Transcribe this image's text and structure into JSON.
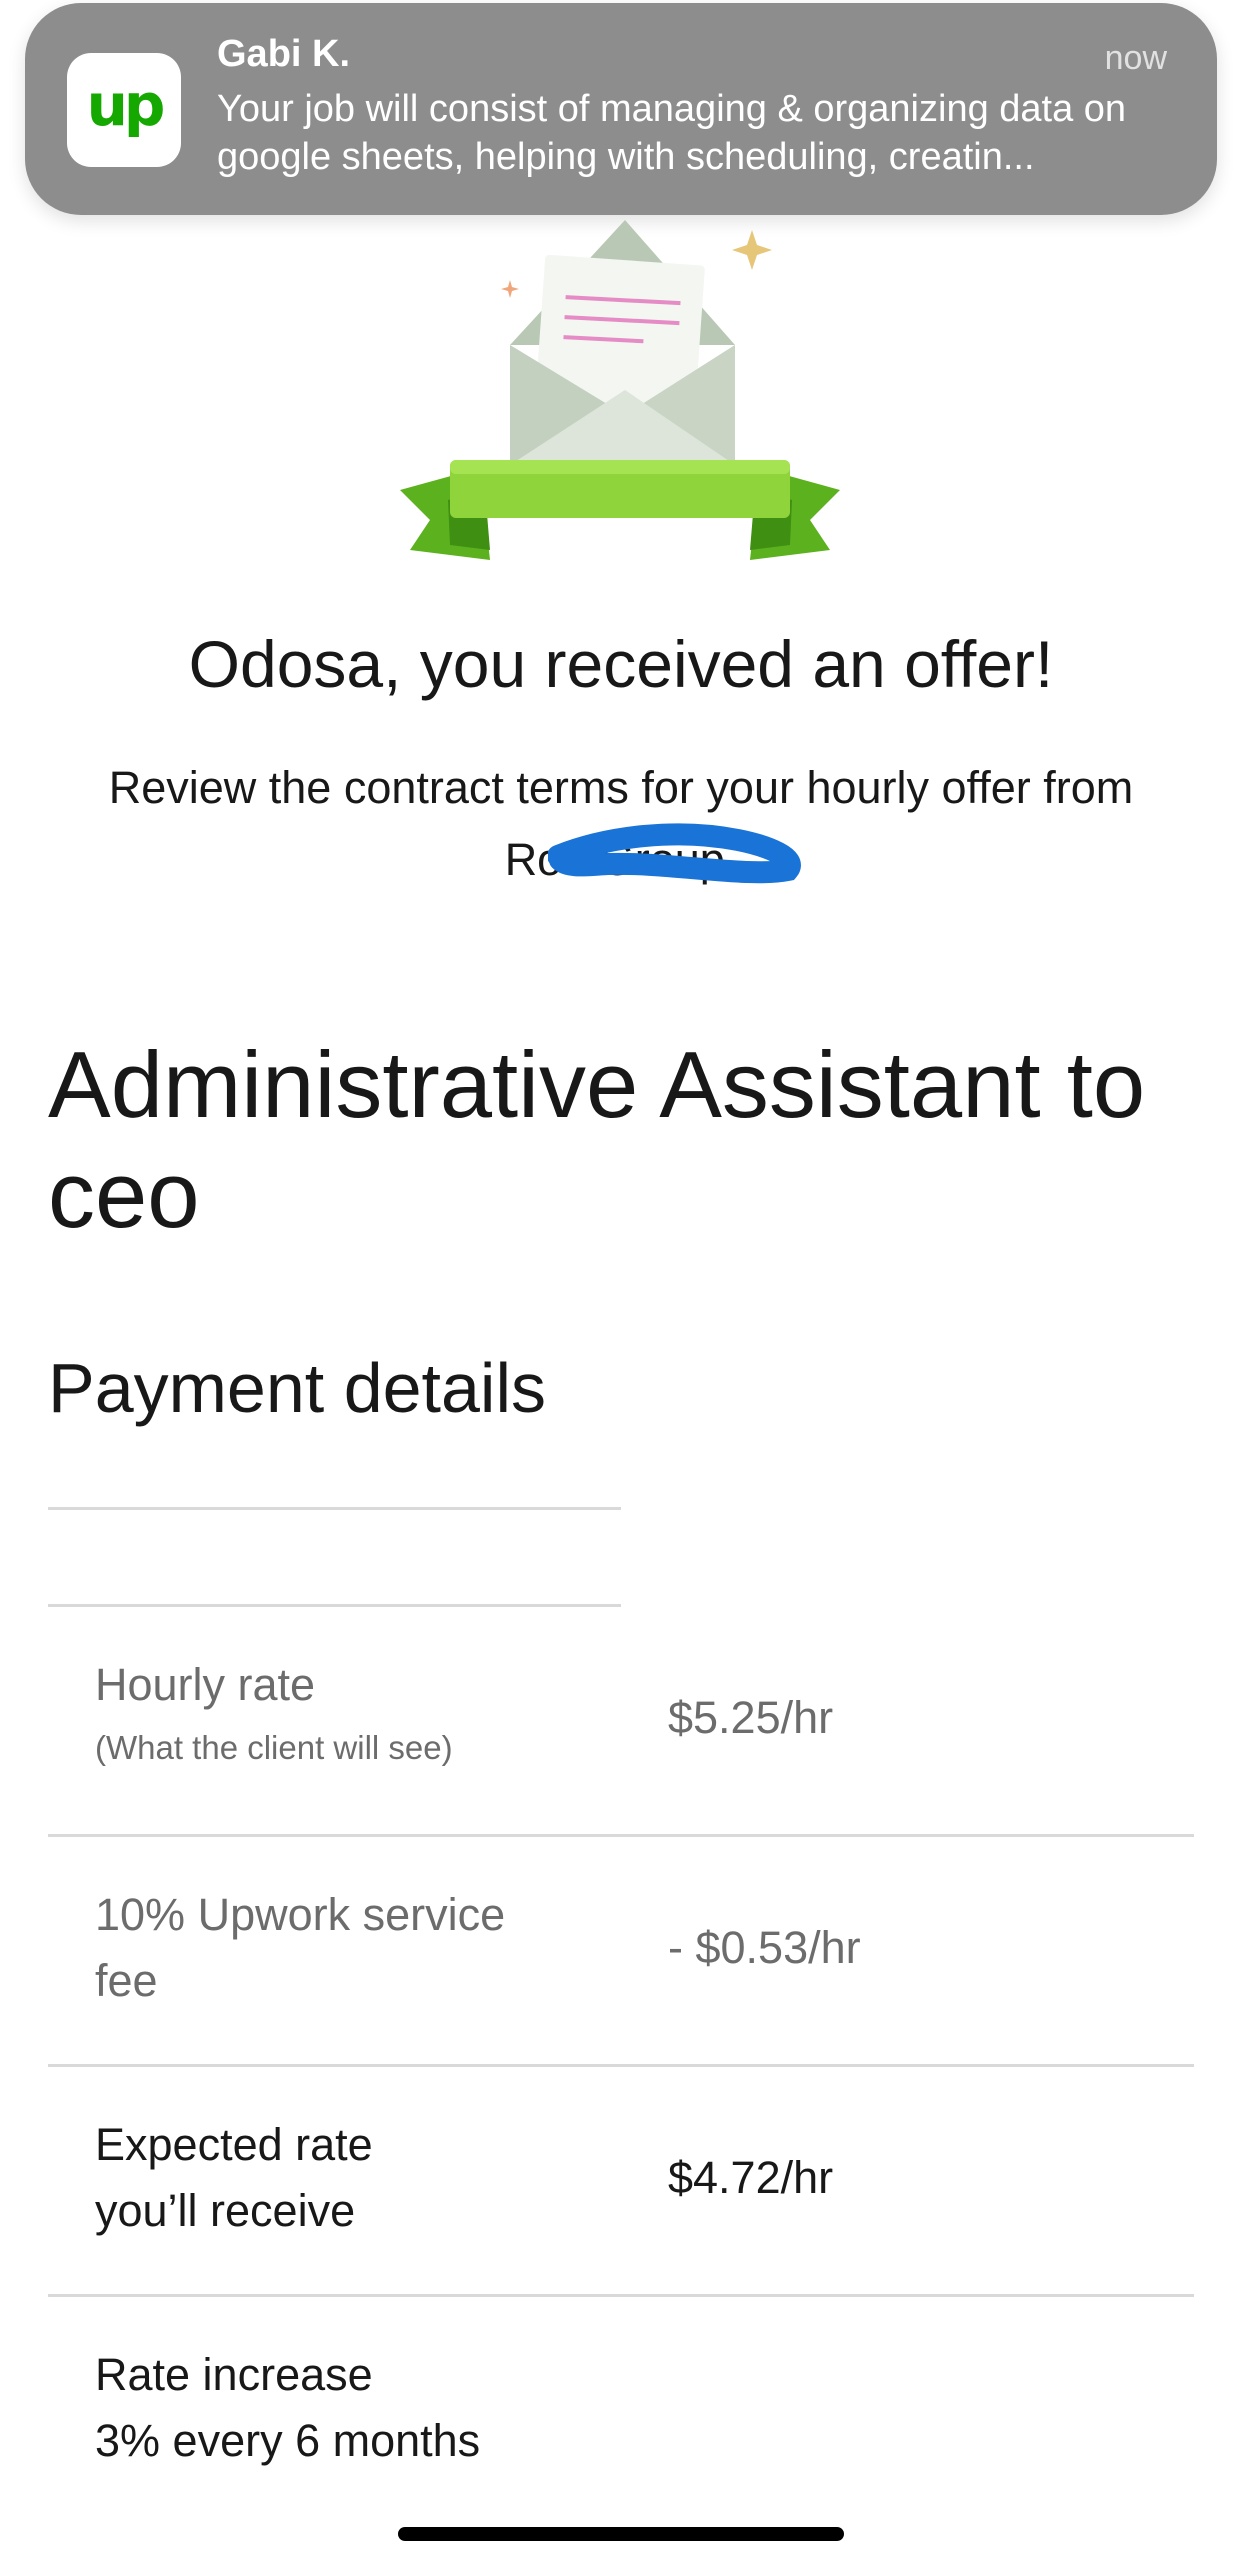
{
  "notification": {
    "app_icon_text": "up",
    "sender": "Gabi K.",
    "time": "now",
    "message": "Your job will consist of managing & organizing data on google sheets, helping with scheduling, creatin..."
  },
  "offer": {
    "headline": "Odosa, you received an offer!",
    "subheadline": "Review the contract terms for your hourly offer from Rod Group."
  },
  "job": {
    "title": "Administrative Assistant to ceo"
  },
  "payment": {
    "title": "Payment details",
    "hourly_rate_label": "Hourly rate",
    "hourly_rate_sublabel": "(What the client will see)",
    "hourly_rate_value": "$5.25/hr",
    "fee_label": "10% Upwork service fee",
    "fee_value": "- $0.53/hr",
    "expected_label": "Expected rate you’ll receive",
    "expected_value": "$4.72/hr",
    "increase_label": "Rate increase",
    "increase_value": "3% every 6 months"
  },
  "colors": {
    "brand_green": "#14a800",
    "ribbon_green": "#8fd43a",
    "redaction_blue": "#1a73d6"
  }
}
